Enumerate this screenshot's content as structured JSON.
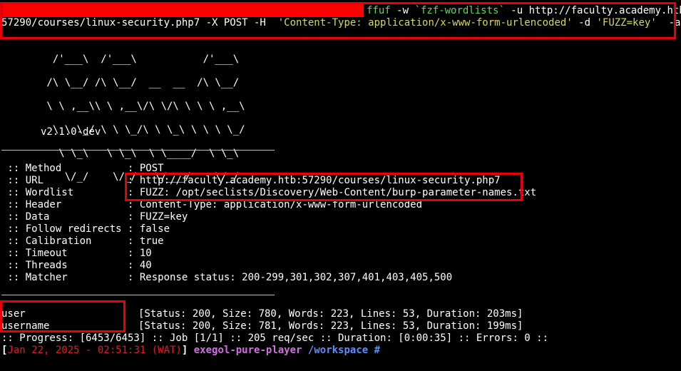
{
  "command": {
    "part1_cmd": "ffuf",
    "part1_flag_w": " -w ",
    "part1_wordlist": "`fzf-wordlists`",
    "part1_flag_u": " -u http://faculty.academy.htb:",
    "part2_url": "57290/courses/linux-security.php7 -X POST -H  ",
    "part2_header": "'Content-Type: application/x-www-form-urlencoded'",
    "part2_flag_d": " -d ",
    "part2_data": "'FUZZ=key'",
    "part2_flag_ac": "  -ac"
  },
  "banner": {
    "logo_lines": [
      "  /'___\\  /'___\\           /'___\\",
      " /\\ \\__/ /\\ \\__/  __  __  /\\ \\__/",
      " \\ \\ ,__\\\\ \\ ,__\\/\\ \\/\\ \\ \\ \\ ,__\\",
      "  \\ \\ \\_/ \\ \\ \\_/\\ \\ \\_\\ \\ \\ \\ \\_/",
      "   \\ \\_\\   \\ \\_\\  \\ \\____/  \\ \\_\\",
      "    \\/_/    \\/_/   \\/___/    \\/_/"
    ],
    "version": "v2.1.0-dev"
  },
  "config": [
    {
      "key": " :: Method           ",
      "value": ": POST"
    },
    {
      "key": " :: URL              ",
      "value": ": http://faculty.academy.htb:57290/courses/linux-security.php7"
    },
    {
      "key": " :: Wordlist         ",
      "value": ": FUZZ: /opt/seclists/Discovery/Web-Content/burp-parameter-names.txt"
    },
    {
      "key": " :: Header           ",
      "value": ": Content-Type: application/x-www-form-urlencoded"
    },
    {
      "key": " :: Data             ",
      "value": ": FUZZ=key"
    },
    {
      "key": " :: Follow redirects ",
      "value": ": false"
    },
    {
      "key": " :: Calibration      ",
      "value": ": true"
    },
    {
      "key": " :: Timeout          ",
      "value": ": 10"
    },
    {
      "key": " :: Threads          ",
      "value": ": 40"
    },
    {
      "key": " :: Matcher          ",
      "value": ": Response status: 200-299,301,302,307,401,403,405,500"
    }
  ],
  "results": [
    {
      "word": "user",
      "info": "[Status: 200, Size: 780, Words: 223, Lines: 53, Duration: 203ms]"
    },
    {
      "word": "username",
      "info": "[Status: 200, Size: 781, Words: 223, Lines: 53, Duration: 199ms]"
    }
  ],
  "progress": ":: Progress: [6453/6453] :: Job [1/1] :: 205 req/sec :: Duration: [0:00:35] :: Errors: 0 ::",
  "prompt": {
    "open": "[",
    "timestamp": "Jan 22, 2025 - 02:51:31 (WAT)",
    "close": "]",
    "host": "exegol-pure-player",
    "path": "/workspace",
    "symbol": "#"
  },
  "colors": {
    "highlight_box": "#e8000b",
    "command_green": "#5fd75f",
    "string_yellow": "#d7d75f",
    "prompt_purple": "#d070e0",
    "path_blue": "#5c8eff"
  }
}
